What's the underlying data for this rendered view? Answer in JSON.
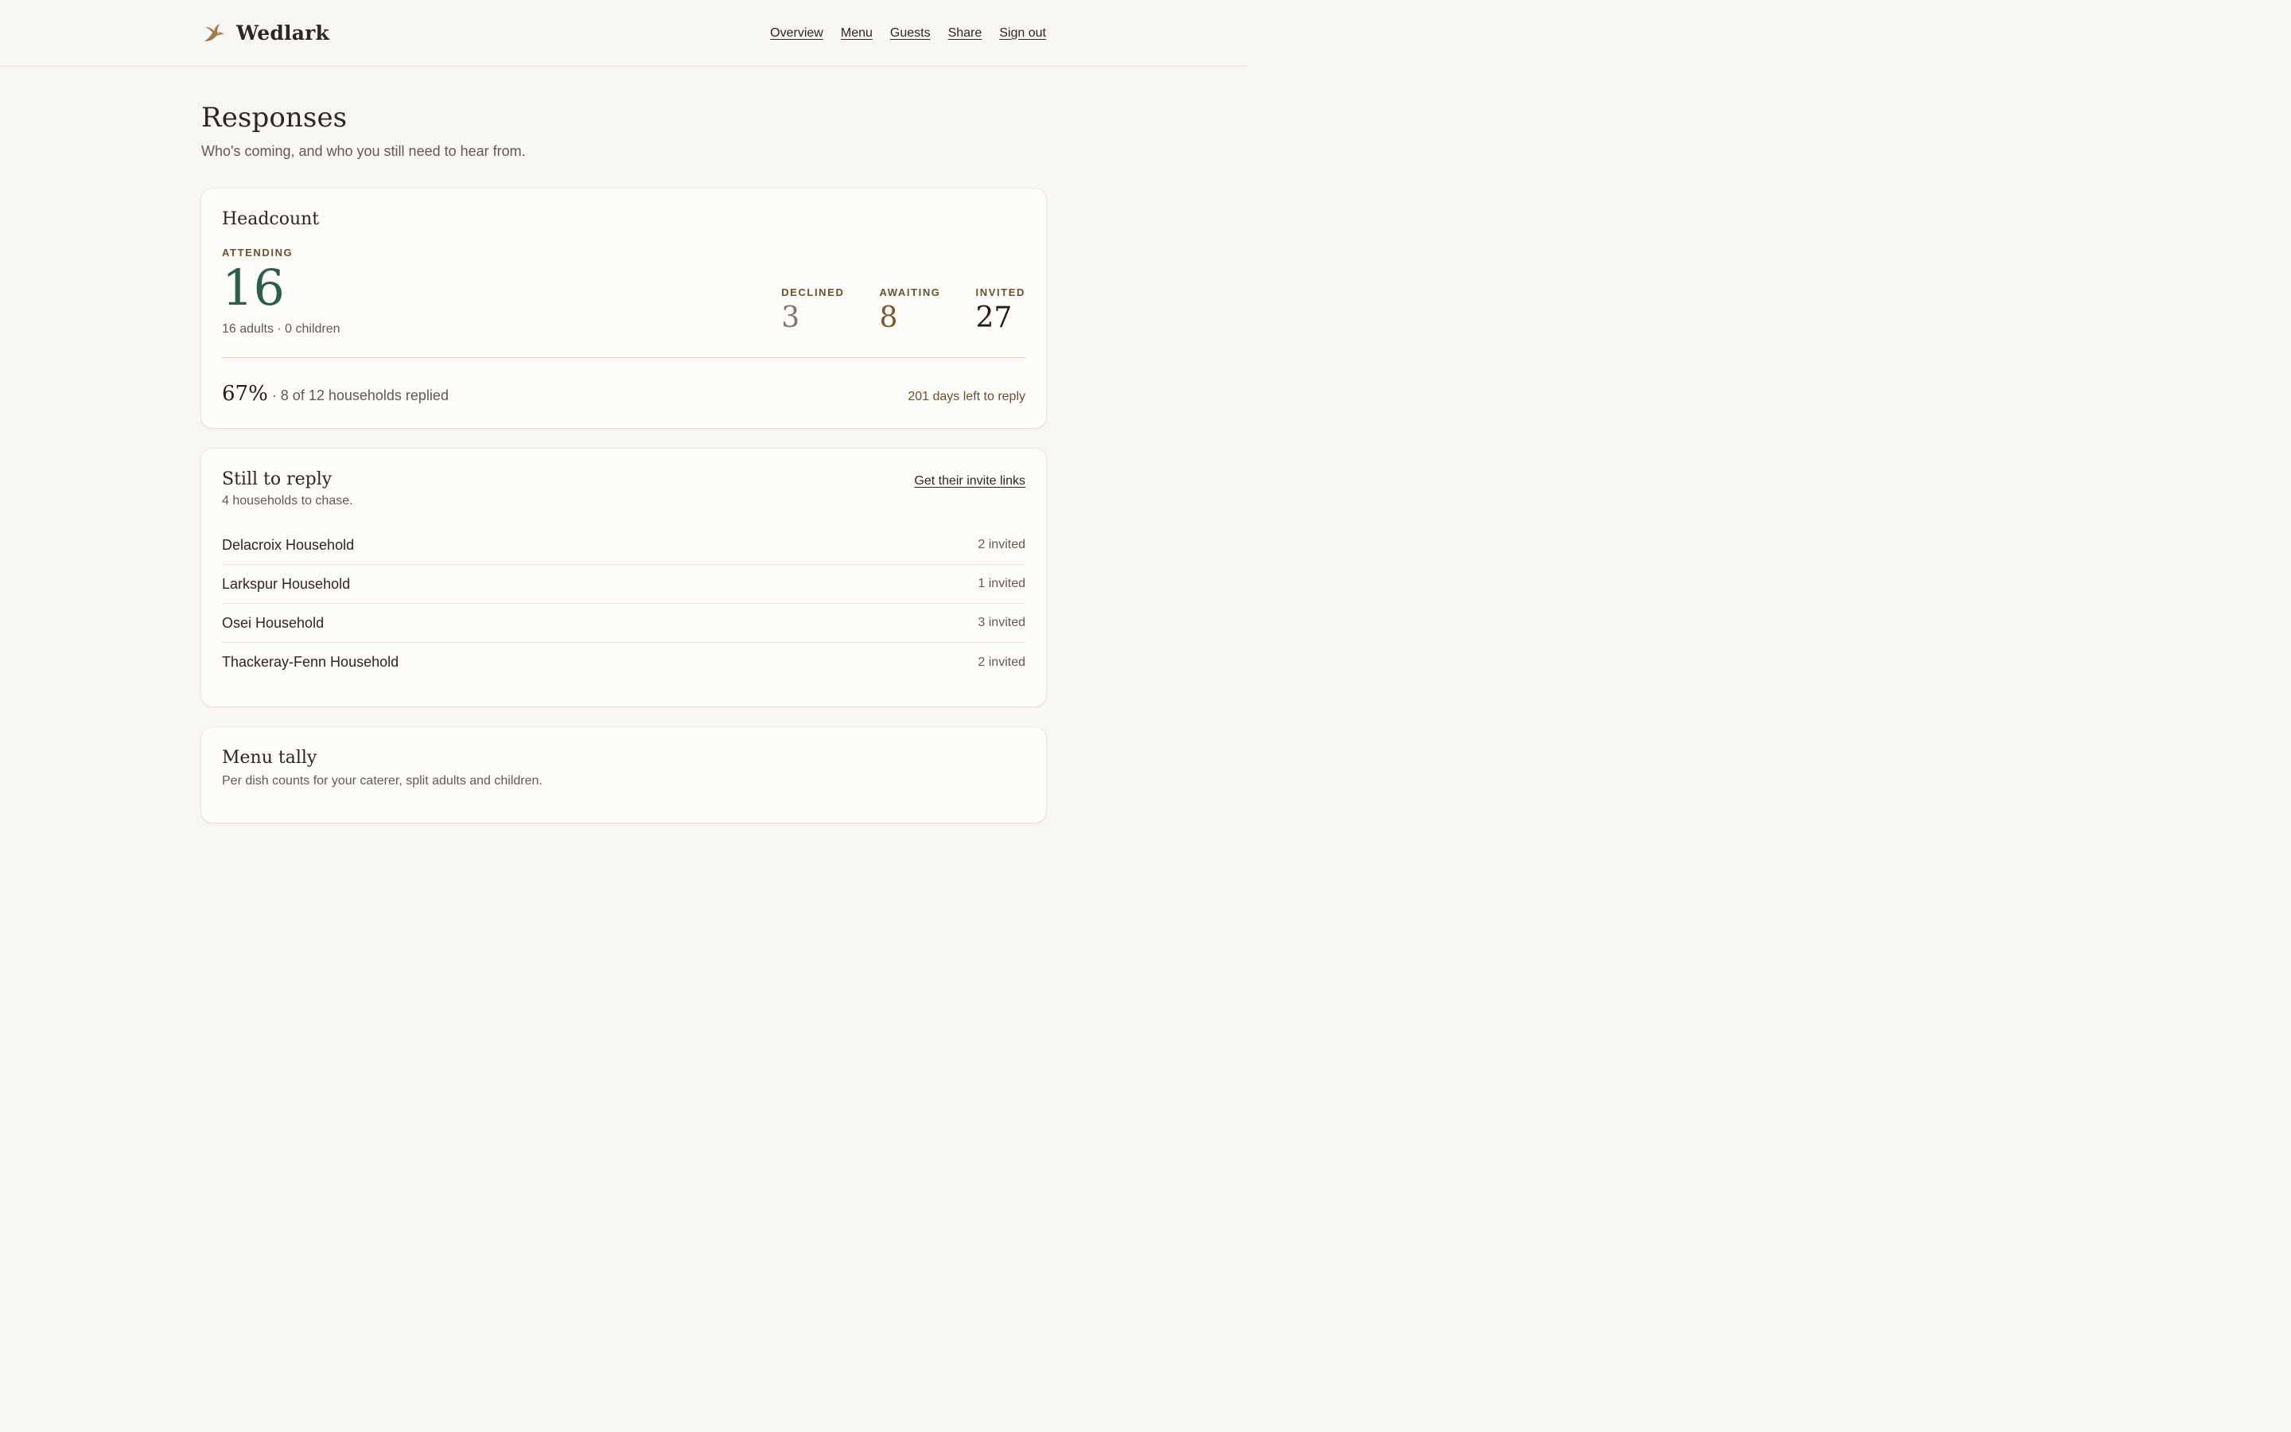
{
  "brand": {
    "name": "Wedlark",
    "logo_icon": "swallow-bird-icon",
    "logo_color": "#a07c4a"
  },
  "nav": [
    {
      "label": "Overview"
    },
    {
      "label": "Menu"
    },
    {
      "label": "Guests"
    },
    {
      "label": "Share"
    },
    {
      "label": "Sign out"
    }
  ],
  "page": {
    "title": "Responses",
    "subtitle": "Who's coming, and who you still need to hear from."
  },
  "headcount": {
    "title": "Headcount",
    "attending_label": "ATTENDING",
    "attending_value": "16",
    "attending_detail": "16 adults · 0 children",
    "stats": [
      {
        "label": "DECLINED",
        "value": "3",
        "color": "#7d7770"
      },
      {
        "label": "AWAITING",
        "value": "8",
        "color": "#7a5a2d"
      },
      {
        "label": "INVITED",
        "value": "27",
        "color": "#1f1c19"
      }
    ],
    "percent": "67%",
    "percent_text": " · 8 of 12 households replied",
    "days_left": "201 days left to reply"
  },
  "still_to_reply": {
    "title": "Still to reply",
    "subtitle": "4 households to chase.",
    "link_label": "Get their invite links",
    "households": [
      {
        "name": "Delacroix Household",
        "count": "2 invited"
      },
      {
        "name": "Larkspur Household",
        "count": "1 invited"
      },
      {
        "name": "Osei Household",
        "count": "3 invited"
      },
      {
        "name": "Thackeray-Fenn Household",
        "count": "2 invited"
      }
    ]
  },
  "menu_tally": {
    "title": "Menu tally",
    "subtitle": "Per dish counts for your caterer, split adults and children."
  },
  "colors": {
    "background": "#f9f7f3",
    "card": "#fdfcf9",
    "accent_green": "#2c5e4e",
    "accent_brown": "#6c4f2c"
  }
}
